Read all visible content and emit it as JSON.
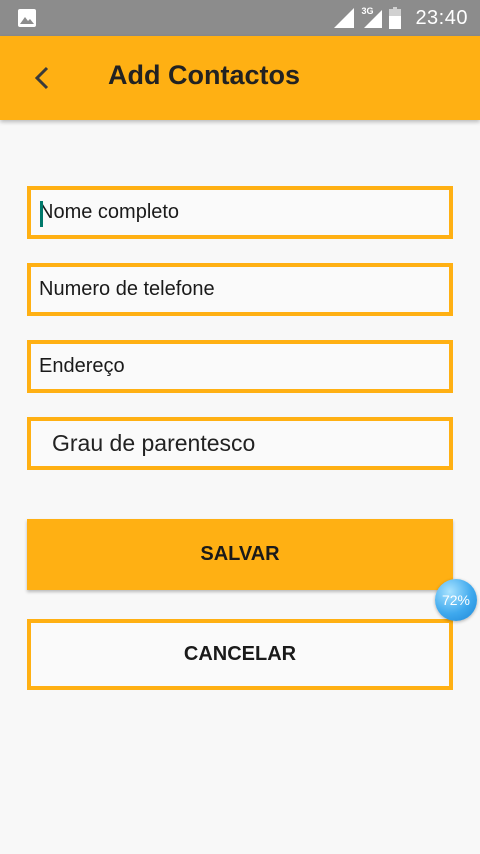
{
  "status_bar": {
    "network": "3G",
    "time": "23:40"
  },
  "app_bar": {
    "title": "Add Contactos"
  },
  "form": {
    "full_name": {
      "placeholder": "Nome completo",
      "value": ""
    },
    "phone": {
      "placeholder": "Numero de telefone",
      "value": ""
    },
    "address": {
      "placeholder": "Endereço",
      "value": ""
    },
    "relationship": {
      "selected": "Grau de parentesco"
    }
  },
  "buttons": {
    "save": "SALVAR",
    "cancel": "CANCELAR"
  },
  "overlay": {
    "percent": "72%"
  },
  "colors": {
    "accent": "#ffb013",
    "status_bar": "#8c8c8c",
    "background": "#f8f8f8",
    "cursor": "#00796b",
    "bubble": "#3fa9ee"
  }
}
